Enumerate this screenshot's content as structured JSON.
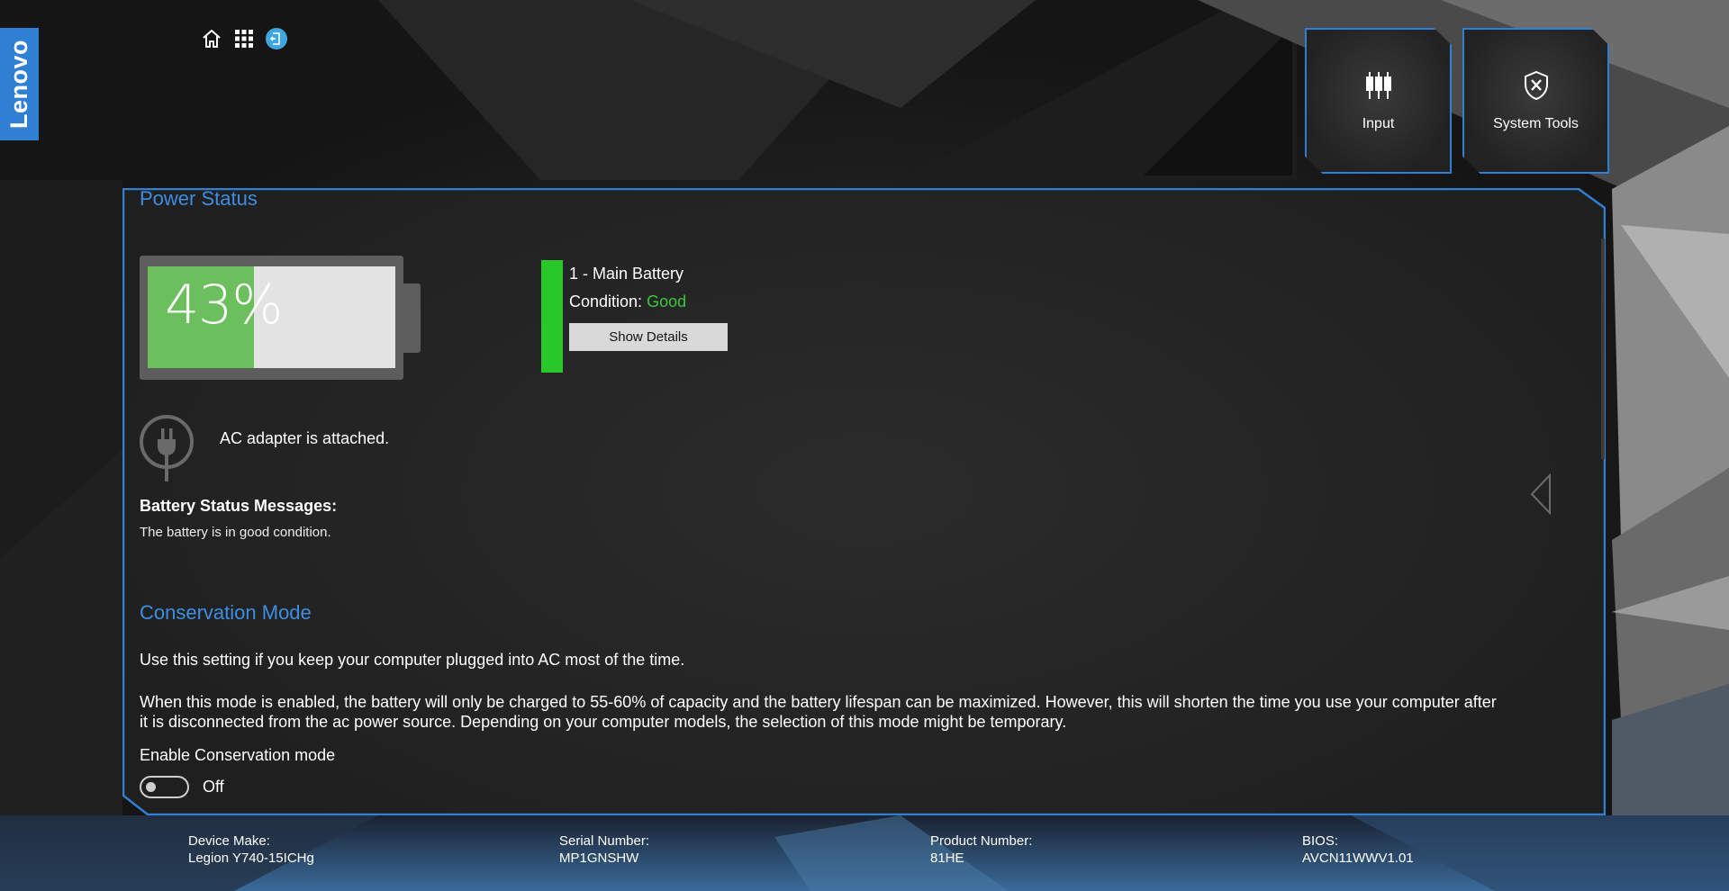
{
  "brand": {
    "logo_text": "Lenovo",
    "accent": "#2f7fd3"
  },
  "topnav": {
    "icons": [
      "home-icon",
      "apps-grid-icon",
      "exit-icon"
    ]
  },
  "tiles": [
    {
      "label": "Input",
      "icon": "input-sliders-icon"
    },
    {
      "label": "System Tools",
      "icon": "system-tools-icon"
    }
  ],
  "power_status": {
    "title": "Power Status",
    "battery_percent_text": "43%",
    "battery_level": 0.43,
    "battery": {
      "name": "1 - Main Battery",
      "condition_label": "Condition:",
      "condition_value": "Good",
      "show_details_label": "Show Details"
    },
    "ac_text": "AC adapter is attached.",
    "messages_title": "Battery Status Messages:",
    "messages_text": "The battery is in good condition."
  },
  "conservation": {
    "title": "Conservation Mode",
    "intro": "Use this setting if you keep your computer plugged into AC most of the time.",
    "description": "When this mode is enabled, the battery will only be charged to 55-60% of capacity and the battery lifespan can be maximized. However, this will shorten the time you use your computer after it is disconnected from the ac power source. Depending on your computer models, the selection of this mode might be temporary.",
    "enable_label": "Enable Conservation mode",
    "toggle_state": "Off"
  },
  "footer": {
    "device_make_label": "Device Make:",
    "device_make_value": "Legion Y740-15ICHg",
    "serial_label": "Serial Number:",
    "serial_value": "MP1GNSHW",
    "product_label": "Product Number:",
    "product_value": "81HE",
    "bios_label": "BIOS:",
    "bios_value": "AVCN11WWV1.01"
  }
}
